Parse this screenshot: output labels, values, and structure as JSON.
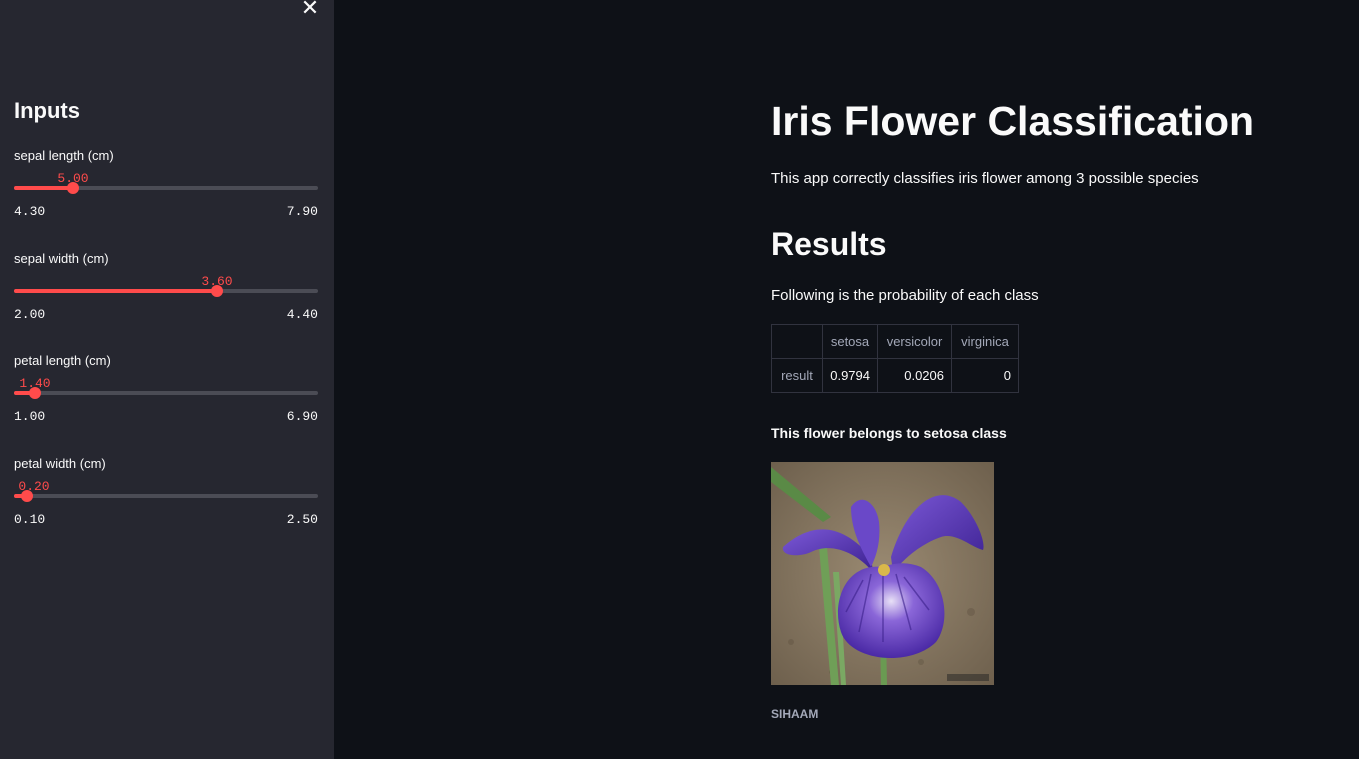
{
  "sidebar": {
    "close_symbol": "✕",
    "heading": "Inputs",
    "sliders": [
      {
        "label": "sepal length (cm)",
        "value": "5.00",
        "min": "4.30",
        "max": "7.90",
        "fraction": 0.194
      },
      {
        "label": "sepal width (cm)",
        "value": "3.60",
        "min": "2.00",
        "max": "4.40",
        "fraction": 0.667
      },
      {
        "label": "petal length (cm)",
        "value": "1.40",
        "min": "1.00",
        "max": "6.90",
        "fraction": 0.068
      },
      {
        "label": "petal width (cm)",
        "value": "0.20",
        "min": "0.10",
        "max": "2.50",
        "fraction": 0.042
      }
    ]
  },
  "main": {
    "title": "Iris Flower Classification",
    "subtitle": "This app correctly classifies iris flower among 3 possible species",
    "results_heading": "Results",
    "probability_text": "Following is the probability of each class",
    "table": {
      "columns": [
        "setosa",
        "versicolor",
        "virginica"
      ],
      "rows": [
        {
          "label": "result",
          "values": [
            "0.9794",
            "0.0206",
            "0"
          ]
        }
      ]
    },
    "belongs_text": "This flower belongs to setosa class",
    "image_caption": "SIHAAM",
    "image_icon": "iris-flower-photo"
  },
  "colors": {
    "accent": "#ff4b4b",
    "sidebar_bg": "#262730",
    "main_bg": "#0e1117"
  }
}
